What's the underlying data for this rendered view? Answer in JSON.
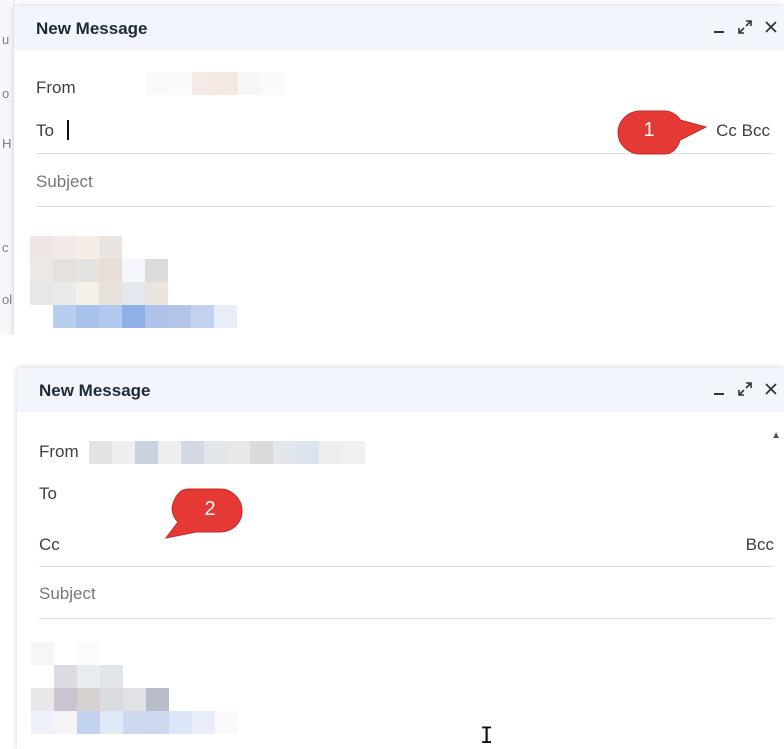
{
  "colors": {
    "title_bar": "#f2f6fc",
    "callout": "#e53935",
    "divider": "#e0e0e0"
  },
  "panel1": {
    "compose": {
      "title": "New Message",
      "controls": {
        "minimize": "minimize-icon",
        "expand": "expand-icon",
        "close": "close-icon"
      },
      "from_label": "From",
      "to_label": "To",
      "cc_bcc": "Cc Bcc",
      "subject_placeholder": "Subject"
    },
    "callout": "1"
  },
  "panel2": {
    "compose": {
      "title": "New Message",
      "controls": {
        "minimize": "minimize-icon",
        "expand": "expand-icon",
        "close": "close-icon"
      },
      "from_label": "From",
      "to_label": "To",
      "cc_label": "Cc",
      "bcc_label": "Bcc",
      "subject_placeholder": "Subject"
    },
    "callout": "2"
  }
}
